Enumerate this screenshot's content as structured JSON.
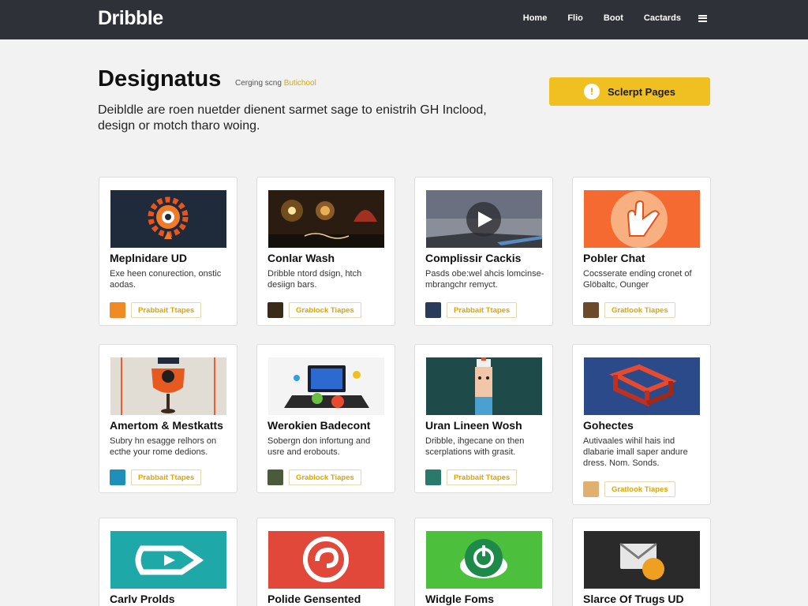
{
  "header": {
    "logo": "Dribble",
    "nav": [
      "Home",
      "Flio",
      "Boot",
      "Cactards"
    ]
  },
  "hero": {
    "title": "Designatus",
    "tag_prefix": "Cerging scng",
    "tag_accent": "Butichool",
    "description": "Deibldle are roen nuetder dienent sarmet sage to enistrih GH Inclood, design or motch tharo woing.",
    "cta_label": "Sclerpt Pages",
    "cta_icon": "!"
  },
  "colors": {
    "topbar": "#2e3238",
    "accent": "#f0c020",
    "background": "#f2f2f2"
  },
  "cards": [
    {
      "title": "Meplnidare UD",
      "desc": "Exe heen conurection, onstic aodas.",
      "tag": "Prabbait Ttapes",
      "icon": "orange-gear-icon",
      "avatar_color": "#f08a24"
    },
    {
      "title": "Conlar Wash",
      "desc": "Dribble ntord dsign, htch desiign bars.",
      "tag": "Grablock Tiapes",
      "icon": "night-lights-icon",
      "avatar_color": "#3a2a1a"
    },
    {
      "title": "Complissir Cackis",
      "desc": "Pasds obe:wel ahcis lomcinse-mbrangchr remyct.",
      "tag": "Prabbait Ttapes",
      "icon": "play-video-icon",
      "avatar_color": "#2a3a5a"
    },
    {
      "title": "Pobler Chat",
      "desc": "Cocsserate ending cronet of Glöbaltc, Ounger",
      "tag": "Gratlook Tiapes",
      "icon": "hand-wave-icon",
      "avatar_color": "#6a4a2a"
    },
    {
      "title": "Amertom & Mestkatts",
      "desc": "Subry hn esagge relhors on ecthe your rome dedions.",
      "tag": "Prabbait Ttapes",
      "icon": "robot-mascot-icon",
      "avatar_color": "#1e8fb8"
    },
    {
      "title": "Werokien Badecont",
      "desc": "Sobergn don infortung and usre and erobouts.",
      "tag": "Grablock Tiapes",
      "icon": "laptop-icon",
      "avatar_color": "#4a5a3a"
    },
    {
      "title": "Uran Lineen Wosh",
      "desc": "Dribble, ihgecane on then scerplations with grasit.",
      "tag": "Prabbait Ttapes",
      "icon": "tall-character-icon",
      "avatar_color": "#2a7a6a"
    },
    {
      "title": "Gohectes",
      "desc": "Autivaales wihil hais ind dlabarie imall saper andure dress. Nom. Sonds.",
      "tag": "Gratlook Tiapes",
      "icon": "isometric-frame-icon",
      "avatar_color": "#e0b070"
    },
    {
      "title": "Carlv Prolds",
      "desc": "",
      "tag": "",
      "icon": "arrow-tag-icon",
      "avatar_color": "#20a8a0"
    },
    {
      "title": "Polide Gensented",
      "desc": "",
      "tag": "",
      "icon": "swirl-logo-icon",
      "avatar_color": "#e04a3a"
    },
    {
      "title": "Widgle Foms",
      "desc": "",
      "tag": "",
      "icon": "power-button-icon",
      "avatar_color": "#50c040"
    },
    {
      "title": "Slarce Of Trugs UD",
      "desc": "",
      "tag": "",
      "icon": "envelope-icon",
      "avatar_color": "#2a2a2a"
    }
  ]
}
